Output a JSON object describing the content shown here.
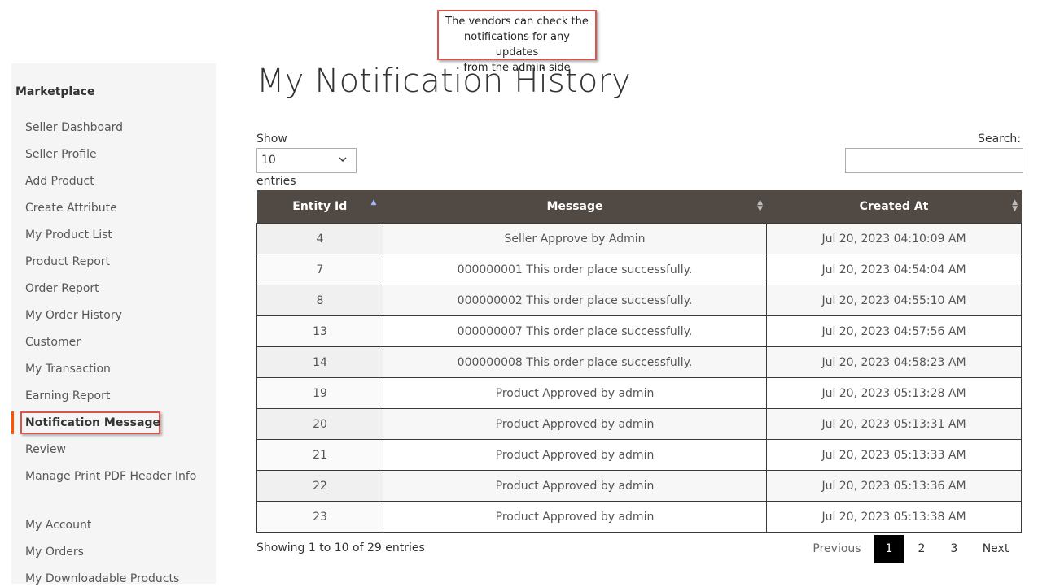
{
  "annotation": {
    "lines": [
      "The vendors can check the",
      "notifications for any updates",
      "from the admin side"
    ],
    "border_color": "#d9534f"
  },
  "sidebar": {
    "title": "Marketplace",
    "items": [
      {
        "label": "Seller Dashboard"
      },
      {
        "label": "Seller Profile"
      },
      {
        "label": "Add Product"
      },
      {
        "label": "Create Attribute"
      },
      {
        "label": "My Product List"
      },
      {
        "label": "Product Report"
      },
      {
        "label": "Order Report"
      },
      {
        "label": "My Order History"
      },
      {
        "label": "Customer"
      },
      {
        "label": "My Transaction"
      },
      {
        "label": "Earning Report"
      },
      {
        "label": "Notification Message",
        "active": true
      },
      {
        "label": "Review"
      },
      {
        "label": "Manage Print PDF Header Info"
      }
    ],
    "account_items": [
      {
        "label": "My Account"
      },
      {
        "label": "My Orders"
      },
      {
        "label": "My Downloadable Products"
      }
    ],
    "accent_color": "#ff5501"
  },
  "page": {
    "title": "My Notification History"
  },
  "table_controls": {
    "show_label": "Show",
    "length_value": "10",
    "entries_label": "entries",
    "search_label": "Search:",
    "search_value": ""
  },
  "table": {
    "columns": [
      "Entity Id",
      "Message",
      "Created At"
    ],
    "header_color": "#514943",
    "rows": [
      {
        "id": "4",
        "message": "Seller Approve by Admin",
        "created": "Jul 20, 2023 04:10:09 AM"
      },
      {
        "id": "7",
        "message": "000000001 This order place successfully.",
        "created": "Jul 20, 2023 04:54:04 AM"
      },
      {
        "id": "8",
        "message": "000000002 This order place successfully.",
        "created": "Jul 20, 2023 04:55:10 AM"
      },
      {
        "id": "13",
        "message": "000000007 This order place successfully.",
        "created": "Jul 20, 2023 04:57:56 AM"
      },
      {
        "id": "14",
        "message": "000000008 This order place successfully.",
        "created": "Jul 20, 2023 04:58:23 AM"
      },
      {
        "id": "19",
        "message": "Product Approved by admin",
        "created": "Jul 20, 2023 05:13:28 AM"
      },
      {
        "id": "20",
        "message": "Product Approved by admin",
        "created": "Jul 20, 2023 05:13:31 AM"
      },
      {
        "id": "21",
        "message": "Product Approved by admin",
        "created": "Jul 20, 2023 05:13:33 AM"
      },
      {
        "id": "22",
        "message": "Product Approved by admin",
        "created": "Jul 20, 2023 05:13:36 AM"
      },
      {
        "id": "23",
        "message": "Product Approved by admin",
        "created": "Jul 20, 2023 05:13:38 AM"
      }
    ]
  },
  "pagination": {
    "info": "Showing 1 to 10 of 29 entries",
    "previous": "Previous",
    "pages": [
      "1",
      "2",
      "3"
    ],
    "current": "1",
    "next": "Next"
  }
}
